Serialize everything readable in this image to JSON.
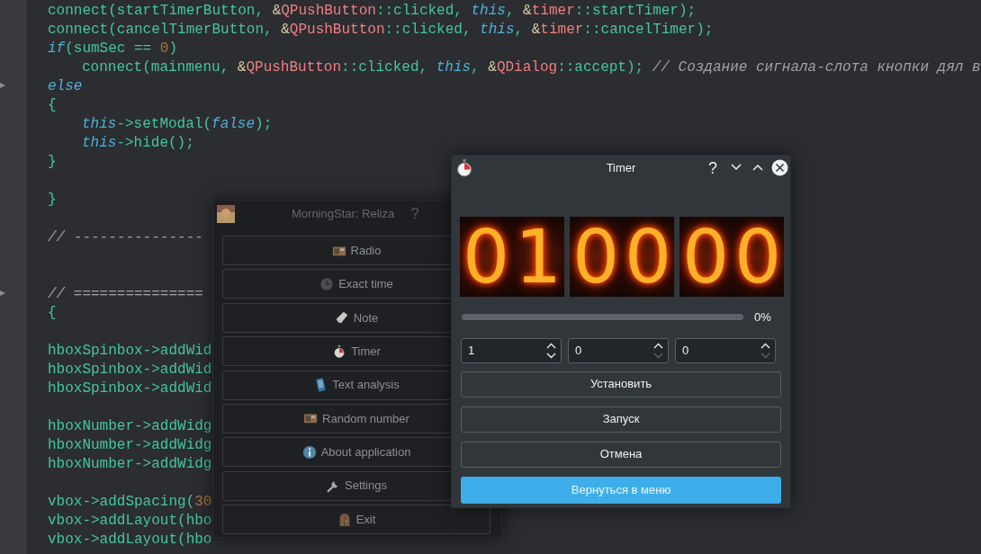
{
  "editor": {
    "lines": [
      {
        "kind": "code",
        "tokens": [
          {
            "kind": "plain",
            "text": "connect(startTimerButton, "
          },
          {
            "kind": "amp",
            "text": "&"
          },
          {
            "kind": "type",
            "text": "QPushButton"
          },
          {
            "kind": "plain",
            "text": "::clicked, "
          },
          {
            "kind": "keyword",
            "text": "this"
          },
          {
            "kind": "plain",
            "text": ", "
          },
          {
            "kind": "amp",
            "text": "&"
          },
          {
            "kind": "type",
            "text": "timer"
          },
          {
            "kind": "plain",
            "text": "::startTimer);"
          }
        ]
      },
      {
        "kind": "code",
        "tokens": [
          {
            "kind": "plain",
            "text": "connect(cancelTimerButton, "
          },
          {
            "kind": "amp",
            "text": "&"
          },
          {
            "kind": "type",
            "text": "QPushButton"
          },
          {
            "kind": "plain",
            "text": "::clicked, "
          },
          {
            "kind": "keyword",
            "text": "this"
          },
          {
            "kind": "plain",
            "text": ", "
          },
          {
            "kind": "amp",
            "text": "&"
          },
          {
            "kind": "type",
            "text": "timer"
          },
          {
            "kind": "plain",
            "text": "::cancelTimer);"
          }
        ]
      },
      {
        "kind": "code",
        "tokens": [
          {
            "kind": "keyword",
            "text": "if"
          },
          {
            "kind": "plain",
            "text": "(sumSec == "
          },
          {
            "kind": "number",
            "text": "0"
          },
          {
            "kind": "plain",
            "text": ")"
          }
        ]
      },
      {
        "kind": "indented_code",
        "tokens": [
          {
            "kind": "plain",
            "text": "connect(mainmenu, "
          },
          {
            "kind": "amp",
            "text": "&"
          },
          {
            "kind": "type",
            "text": "QPushButton"
          },
          {
            "kind": "plain",
            "text": "::clicked, "
          },
          {
            "kind": "keyword",
            "text": "this"
          },
          {
            "kind": "plain",
            "text": ", "
          },
          {
            "kind": "amp",
            "text": "&"
          },
          {
            "kind": "type",
            "text": "QDialog"
          },
          {
            "kind": "plain",
            "text": "::accept); "
          },
          {
            "kind": "comment",
            "text": "// Создание сигнала-слота кнопки дял в"
          }
        ]
      },
      {
        "kind": "code",
        "tokens": [
          {
            "kind": "keyword",
            "text": "else"
          }
        ]
      },
      {
        "kind": "code",
        "tokens": [
          {
            "kind": "plain",
            "text": "{"
          }
        ]
      },
      {
        "kind": "indented_code",
        "tokens": [
          {
            "kind": "keyword",
            "text": "this"
          },
          {
            "kind": "plain",
            "text": "->setModal("
          },
          {
            "kind": "keyword",
            "text": "false"
          },
          {
            "kind": "plain",
            "text": ");"
          }
        ]
      },
      {
        "kind": "indented_code",
        "tokens": [
          {
            "kind": "keyword",
            "text": "this"
          },
          {
            "kind": "plain",
            "text": "->hide();"
          }
        ]
      },
      {
        "kind": "code",
        "tokens": [
          {
            "kind": "plain",
            "text": "}"
          }
        ]
      },
      {
        "kind": "blank"
      },
      {
        "kind": "code",
        "tokens": [
          {
            "kind": "plain",
            "text": "}"
          }
        ]
      },
      {
        "kind": "blank"
      },
      {
        "kind": "code",
        "tokens": [
          {
            "kind": "comment",
            "text": "// ---------------"
          }
        ]
      },
      {
        "kind": "blank"
      },
      {
        "kind": "blank"
      },
      {
        "kind": "code",
        "tokens": [
          {
            "kind": "comment",
            "text": "// ==============="
          }
        ]
      },
      {
        "kind": "code",
        "tokens": [
          {
            "kind": "plain",
            "text": "{"
          }
        ]
      },
      {
        "kind": "blank"
      },
      {
        "kind": "code",
        "tokens": [
          {
            "kind": "plain",
            "text": "hboxSpinbox->addWid"
          }
        ]
      },
      {
        "kind": "code",
        "tokens": [
          {
            "kind": "plain",
            "text": "hboxSpinbox->addWid"
          }
        ]
      },
      {
        "kind": "code",
        "tokens": [
          {
            "kind": "plain",
            "text": "hboxSpinbox->addWid"
          }
        ]
      },
      {
        "kind": "blank"
      },
      {
        "kind": "code",
        "tokens": [
          {
            "kind": "plain",
            "text": "hboxNumber->addWidg"
          }
        ]
      },
      {
        "kind": "code",
        "tokens": [
          {
            "kind": "plain",
            "text": "hboxNumber->addWidg"
          }
        ]
      },
      {
        "kind": "code",
        "tokens": [
          {
            "kind": "plain",
            "text": "hboxNumber->addWidg"
          }
        ]
      },
      {
        "kind": "blank"
      },
      {
        "kind": "code",
        "tokens": [
          {
            "kind": "plain",
            "text": "vbox->addSpacing("
          },
          {
            "kind": "number",
            "text": "30"
          }
        ]
      },
      {
        "kind": "code",
        "tokens": [
          {
            "kind": "plain",
            "text": "vbox->addLayout(hbo"
          }
        ]
      },
      {
        "kind": "code",
        "tokens": [
          {
            "kind": "plain",
            "text": "vbox->addLayout(hbo"
          }
        ]
      }
    ]
  },
  "menu_window": {
    "title": "MorningStar: Reliza",
    "help": "?",
    "buttons": [
      {
        "label": "Radio"
      },
      {
        "label": "Exact time"
      },
      {
        "label": "Note"
      },
      {
        "label": "Timer"
      },
      {
        "label": "Text analysis"
      },
      {
        "label": "Random number"
      },
      {
        "label": "About application"
      },
      {
        "label": "Settings"
      },
      {
        "label": "Exit"
      }
    ]
  },
  "timer_window": {
    "title": "Timer",
    "help": "?",
    "digits": [
      "0",
      "1",
      "0",
      "0",
      "0",
      "0"
    ],
    "progress": {
      "level": 0,
      "reading": "0%"
    },
    "spinboxes": [
      {
        "value": "1",
        "at_minimum": false
      },
      {
        "value": "0",
        "at_minimum": true
      },
      {
        "value": "0",
        "at_minimum": true
      }
    ],
    "buttons": [
      {
        "label": "Установить",
        "kind": "normal"
      },
      {
        "label": "Запуск",
        "kind": "normal"
      },
      {
        "label": "Отмена",
        "kind": "normal"
      },
      {
        "label": "Вернуться в меню",
        "kind": "primary"
      }
    ]
  }
}
